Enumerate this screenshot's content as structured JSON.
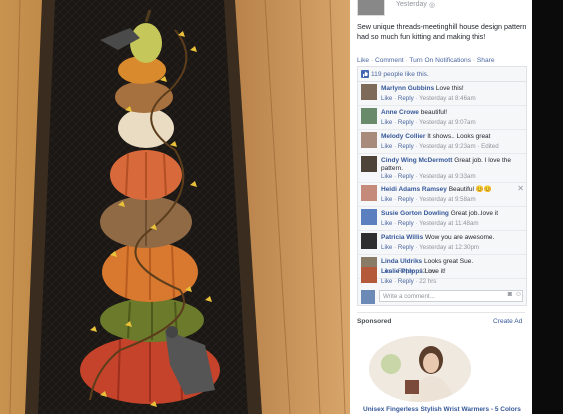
{
  "post": {
    "time": "Yesterday",
    "text": "Sew unique threads-meetinghill house design pattern had so much fun kitting and making this!",
    "actions": [
      "Like",
      "Comment",
      "Turn On Notifications",
      "Share"
    ]
  },
  "likes": {
    "text": "119 people like this."
  },
  "comments": [
    {
      "name": "Marlynn Gubbins",
      "text": "Love this!",
      "meta": "Yesterday at 8:46am"
    },
    {
      "name": "Anne Crowe",
      "text": "beautiful!",
      "meta": "Yesterday at 9:07am"
    },
    {
      "name": "Melody Collier",
      "text": "It shows.. Looks great",
      "meta": "Yesterday at 9:23am · Edited"
    },
    {
      "name": "Cindy Wing McDermott",
      "text": "Great job. I love the pattern.",
      "meta": "Yesterday at 9:33am"
    },
    {
      "name": "Heidi Adams Ramsey",
      "text": "Beautiful 😊😊",
      "meta": "Yesterday at 9:58am"
    },
    {
      "name": "Susie Gorton Dowling",
      "text": "Great job..love it",
      "meta": "Yesterday at 11:48am"
    },
    {
      "name": "Patricia Willis",
      "text": "Wow you are awesome.",
      "meta": "Yesterday at 12:30pm"
    },
    {
      "name": "Linda Uldriks",
      "text": "Looks great Sue.",
      "meta": "22 hrs"
    },
    {
      "name": "Leslie Phipps",
      "text": "Love it!",
      "meta": "22 hrs"
    }
  ],
  "comment_actions": {
    "like": "Like",
    "reply": "Reply"
  },
  "write_comment": {
    "placeholder": "Write a comment..."
  },
  "sponsored": {
    "label": "Sponsored",
    "create_ad": "Create Ad",
    "ad_title": "Unisex Fingerless Stylish Wrist Warmers - 5 Colors"
  },
  "colors": {
    "link": "#365899",
    "meta": "#90949c",
    "panel_bg": "#f6f7f9"
  }
}
